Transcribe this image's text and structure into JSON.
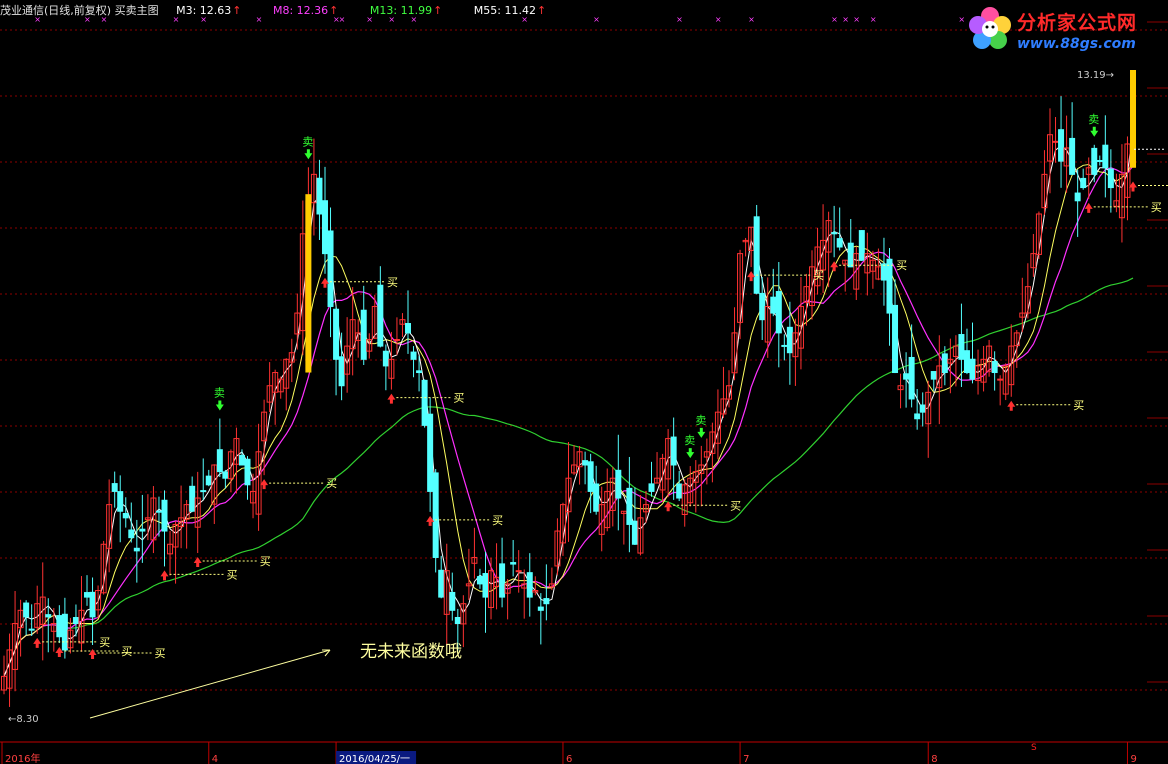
{
  "header": {
    "title": "茂业通信(日线,前复权) 买卖主图",
    "m3_label": "M3: 12.63",
    "m8_label": "M8: 12.36",
    "m13_label": "M13: 11.99",
    "m55_label": "M55: 11.42"
  },
  "logo": {
    "title": "分析家公式网",
    "url": "www.88gs.com"
  },
  "colors": {
    "background": "#000000",
    "up_candle": "#ff3232",
    "down_candle": "#54ffff",
    "m3": "#ffffff",
    "m8": "#ffff60",
    "m13": "#ff30ff",
    "m55": "#30d030",
    "buy_text": "#ffff80",
    "sell_text": "#30ff30",
    "grid": "#8b0000",
    "axis_text": "#ff4040",
    "gold_bar": "#ffcc00"
  },
  "annotation_text": "无未来函数哦",
  "chart_data": {
    "type": "candlestick",
    "ylim": [
      8.3,
      13.19
    ],
    "y_min_label": "8.30",
    "y_max_label": "13.19",
    "x_tick_labels": [
      "2016年",
      "4",
      "2016/04/25/一",
      "6",
      "7",
      "8",
      "9"
    ],
    "x_tick_index": [
      0,
      37,
      60,
      101,
      133,
      167,
      203
    ],
    "gap_marker": "S",
    "legend": {
      "M3": 12.63,
      "M8": 12.36,
      "M13": 11.99,
      "M55": 11.42
    },
    "closes": [
      8.6,
      8.8,
      9.0,
      9.1,
      9.05,
      8.95,
      9.15,
      9.2,
      9.05,
      9.0,
      8.9,
      8.8,
      8.95,
      9.0,
      9.1,
      9.2,
      9.05,
      9.25,
      9.6,
      9.9,
      10.0,
      9.85,
      9.8,
      9.65,
      9.55,
      9.7,
      9.8,
      9.95,
      9.85,
      9.7,
      9.6,
      9.75,
      9.8,
      9.9,
      9.85,
      9.95,
      10.0,
      10.05,
      10.2,
      10.15,
      10.1,
      10.3,
      10.4,
      10.2,
      10.05,
      10.0,
      10.3,
      10.6,
      10.8,
      10.9,
      10.85,
      11.0,
      11.05,
      11.35,
      11.95,
      12.2,
      12.4,
      12.1,
      11.8,
      11.4,
      11.0,
      10.8,
      11.1,
      11.3,
      11.2,
      11.0,
      11.15,
      11.4,
      11.1,
      10.95,
      11.0,
      11.15,
      11.3,
      11.2,
      11.0,
      10.9,
      10.5,
      10.0,
      9.5,
      9.2,
      9.4,
      9.1,
      9.0,
      9.15,
      9.3,
      9.5,
      9.3,
      9.2,
      9.4,
      9.35,
      9.2,
      9.3,
      9.45,
      9.4,
      9.3,
      9.2,
      9.25,
      9.1,
      9.15,
      9.3,
      9.7,
      9.9,
      10.1,
      10.2,
      10.3,
      10.2,
      10.0,
      9.85,
      9.9,
      10.0,
      10.1,
      9.95,
      9.85,
      9.75,
      9.6,
      9.8,
      9.9,
      10.0,
      10.1,
      10.25,
      10.4,
      10.2,
      9.95,
      10.05,
      10.1,
      10.15,
      10.2,
      10.3,
      10.45,
      10.6,
      10.7,
      10.8,
      11.2,
      11.8,
      11.9,
      12.0,
      11.5,
      11.3,
      11.4,
      11.35,
      11.2,
      11.1,
      11.05,
      11.2,
      11.4,
      11.55,
      11.7,
      11.85,
      11.9,
      12.05,
      11.95,
      11.85,
      11.75,
      11.7,
      11.8,
      11.75,
      11.8,
      11.75,
      11.7,
      11.6,
      11.35,
      10.9,
      10.8,
      10.85,
      10.7,
      10.55,
      10.6,
      10.75,
      10.85,
      10.95,
      10.9,
      11.0,
      11.1,
      11.0,
      10.9,
      10.85,
      10.95,
      11.0,
      11.1,
      10.9,
      10.85,
      10.95,
      11.1,
      11.2,
      11.35,
      11.55,
      11.8,
      12.1,
      12.4,
      12.7,
      12.65,
      12.5,
      12.6,
      12.4,
      12.2,
      12.3,
      12.45,
      12.4,
      12.5,
      12.45,
      12.3,
      12.2,
      12.4,
      12.63,
      13.19
    ]
  },
  "signals": {
    "buy_label": "买",
    "sell_label": "卖",
    "buy_events": [
      6,
      10,
      16,
      29,
      35,
      47,
      58,
      70,
      77,
      120,
      135,
      150,
      182,
      196,
      204
    ],
    "sell_events": [
      39,
      55,
      124,
      126,
      197
    ]
  }
}
